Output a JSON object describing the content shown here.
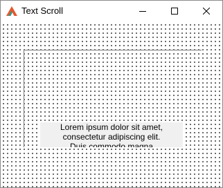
{
  "window": {
    "title": "Text Scroll",
    "icon": "app-logo-icon",
    "controls": {
      "minimize_icon": "minimize-icon",
      "maximize_icon": "maximize-icon",
      "close_icon": "close-icon"
    }
  },
  "content": {
    "scroll_text": "Lorem ipsum dolor sit amet,\nconsectetur adipiscing elit.\nDuis commodo magna"
  },
  "colors": {
    "icon_orange": "#e8562a",
    "icon_teal": "#2a9d8f",
    "dots": "#1a1a1a",
    "text_box_bg": "#f0f0f0"
  }
}
